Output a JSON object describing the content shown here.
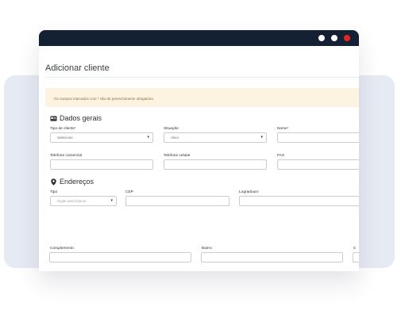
{
  "colors": {
    "titlebar": "#142033",
    "backdrop": "#e6eaf3",
    "notice_bg": "#fcf3e1",
    "required_mark": "#e23b3b",
    "close_dot": "#e22626"
  },
  "page": {
    "title": "Adicionar cliente"
  },
  "notice": {
    "prefix": "Os campos marcados com",
    "mark": "*",
    "suffix": "são de preenchimento obrigatório."
  },
  "dados_gerais": {
    "heading": "Dados gerais",
    "icon": "id-card-icon",
    "tipo_label": "Tipo de cliente",
    "tipo_value": "Selecione",
    "situacao_label": "Situação",
    "situacao_value": "Ativo",
    "nome_label": "Nome",
    "telefone_comercial_label": "Telefone comercial",
    "telefone_celular_label": "Telefone celular",
    "fax_label": "FAX"
  },
  "enderecos": {
    "heading": "Endereços",
    "icon": "map-pin-icon",
    "tipo_label": "Tipo",
    "tipo_placeholder": "Digite para buscar",
    "cep_label": "CEP",
    "logradouro_label": "Logradouro",
    "complemento_label": "Complemento",
    "bairro_label": "Bairro",
    "cut_label": "C"
  },
  "required_mark": "*",
  "dropdown_glyph": "▾"
}
